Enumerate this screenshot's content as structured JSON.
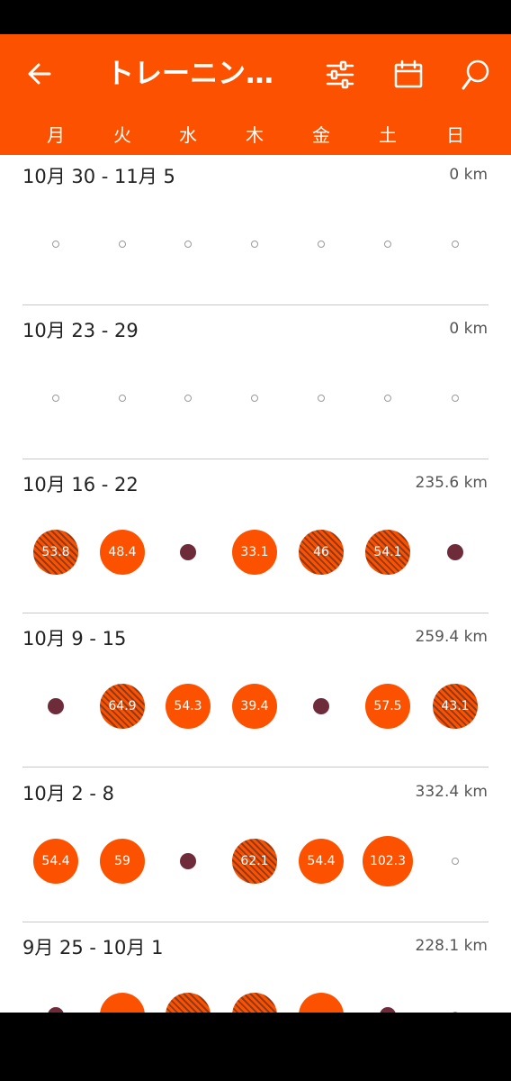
{
  "header": {
    "title": "トレーニン…",
    "weekdays": [
      "月",
      "火",
      "水",
      "木",
      "金",
      "土",
      "日"
    ]
  },
  "colors": {
    "accent": "#fc5200",
    "rest_dot": "#6e2b3a",
    "hatch_dark": "#8f3a1c"
  },
  "weeks": [
    {
      "label": "10月 30 - 11月 5",
      "total": "0 km",
      "days": [
        {
          "type": "empty"
        },
        {
          "type": "empty"
        },
        {
          "type": "empty"
        },
        {
          "type": "empty"
        },
        {
          "type": "empty"
        },
        {
          "type": "empty"
        },
        {
          "type": "empty"
        }
      ]
    },
    {
      "label": "10月 23 - 29",
      "total": "0 km",
      "days": [
        {
          "type": "empty"
        },
        {
          "type": "empty"
        },
        {
          "type": "empty"
        },
        {
          "type": "empty"
        },
        {
          "type": "empty"
        },
        {
          "type": "empty"
        },
        {
          "type": "empty"
        }
      ]
    },
    {
      "label": "10月 16 - 22",
      "total": "235.6 km",
      "days": [
        {
          "type": "run",
          "value": "53.8",
          "hatched": true
        },
        {
          "type": "run",
          "value": "48.4",
          "hatched": false
        },
        {
          "type": "rest"
        },
        {
          "type": "run",
          "value": "33.1",
          "hatched": false
        },
        {
          "type": "run",
          "value": "46",
          "hatched": true
        },
        {
          "type": "run",
          "value": "54.1",
          "hatched": true
        },
        {
          "type": "rest"
        }
      ]
    },
    {
      "label": "10月 9 - 15",
      "total": "259.4 km",
      "days": [
        {
          "type": "rest"
        },
        {
          "type": "run",
          "value": "64.9",
          "hatched": true
        },
        {
          "type": "run",
          "value": "54.3",
          "hatched": false
        },
        {
          "type": "run",
          "value": "39.4",
          "hatched": false
        },
        {
          "type": "rest"
        },
        {
          "type": "run",
          "value": "57.5",
          "hatched": false
        },
        {
          "type": "run",
          "value": "43.1",
          "hatched": true
        }
      ]
    },
    {
      "label": "10月 2 - 8",
      "total": "332.4 km",
      "days": [
        {
          "type": "run",
          "value": "54.4",
          "hatched": false
        },
        {
          "type": "run",
          "value": "59",
          "hatched": false
        },
        {
          "type": "rest"
        },
        {
          "type": "run",
          "value": "62.1",
          "hatched": true
        },
        {
          "type": "run",
          "value": "54.4",
          "hatched": false
        },
        {
          "type": "run",
          "value": "102.3",
          "hatched": false
        },
        {
          "type": "empty"
        }
      ]
    },
    {
      "label": "9月 25 - 10月 1",
      "total": "228.1 km",
      "days": [
        {
          "type": "rest"
        },
        {
          "type": "run",
          "value": "",
          "hatched": false
        },
        {
          "type": "run",
          "value": "",
          "hatched": true
        },
        {
          "type": "run",
          "value": "",
          "hatched": true
        },
        {
          "type": "run",
          "value": "",
          "hatched": false
        },
        {
          "type": "rest"
        },
        {
          "type": "empty"
        }
      ]
    }
  ]
}
